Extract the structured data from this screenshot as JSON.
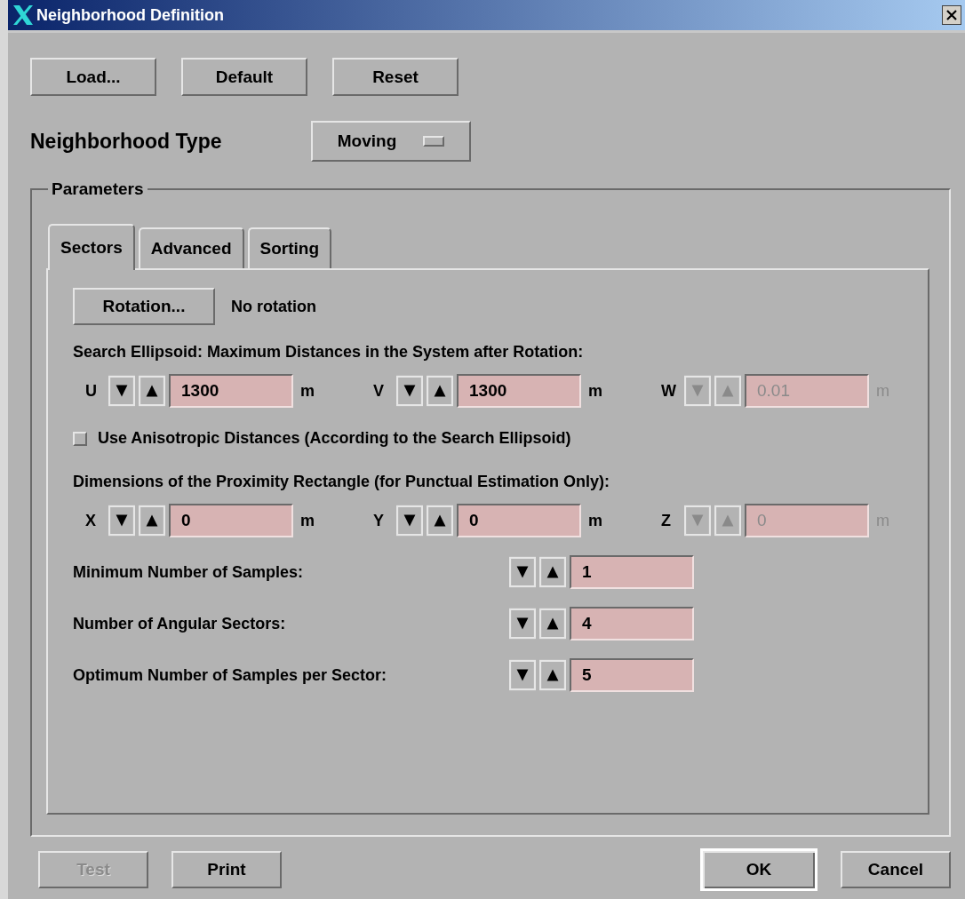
{
  "window": {
    "title": "Neighborhood Definition"
  },
  "top_buttons": [
    {
      "label": "Load...",
      "disabled": false
    },
    {
      "label": "Default",
      "disabled": false
    },
    {
      "label": "Reset",
      "disabled": false
    }
  ],
  "neighborhood_type": {
    "label": "Neighborhood Type",
    "value": "Moving"
  },
  "parameters": {
    "title": "Parameters",
    "tabs": [
      {
        "label": "Sectors",
        "selected": true
      },
      {
        "label": "Advanced",
        "selected": false
      },
      {
        "label": "Sorting",
        "selected": false
      }
    ],
    "rotation": {
      "button": "Rotation...",
      "value": "No rotation"
    },
    "search_heading": "Search Ellipsoid: Maximum Distances in the System after Rotation:",
    "search_fields": [
      {
        "axis": "U",
        "value": "1300",
        "unit": "m",
        "disabled": false
      },
      {
        "axis": "V",
        "value": "1300",
        "unit": "m",
        "disabled": false
      },
      {
        "axis": "W",
        "value": "0.01",
        "unit": "m",
        "disabled": true
      }
    ],
    "anisotropic": {
      "label": "Use Anisotropic Distances (According to the Search Ellipsoid)",
      "checked": false
    },
    "rectangle_heading": "Dimensions of the Proximity Rectangle (for Punctual Estimation Only):",
    "rectangle_fields": [
      {
        "axis": "X",
        "value": "0",
        "unit": "m",
        "disabled": false
      },
      {
        "axis": "Y",
        "value": "0",
        "unit": "m",
        "disabled": false
      },
      {
        "axis": "Z",
        "value": "0",
        "unit": "m",
        "disabled": true
      }
    ],
    "count_fields": [
      {
        "label": "Minimum Number of Samples:",
        "value": "1"
      },
      {
        "label": "Number of Angular Sectors:",
        "value": "4"
      },
      {
        "label": "Optimum Number of Samples per Sector:",
        "value": "5"
      }
    ]
  },
  "bottom_buttons": [
    {
      "label": "Test",
      "disabled": true,
      "default": false
    },
    {
      "label": "Print",
      "disabled": false,
      "default": false
    },
    {
      "label": "OK",
      "disabled": false,
      "default": true
    },
    {
      "label": "Cancel",
      "disabled": false,
      "default": false
    }
  ]
}
